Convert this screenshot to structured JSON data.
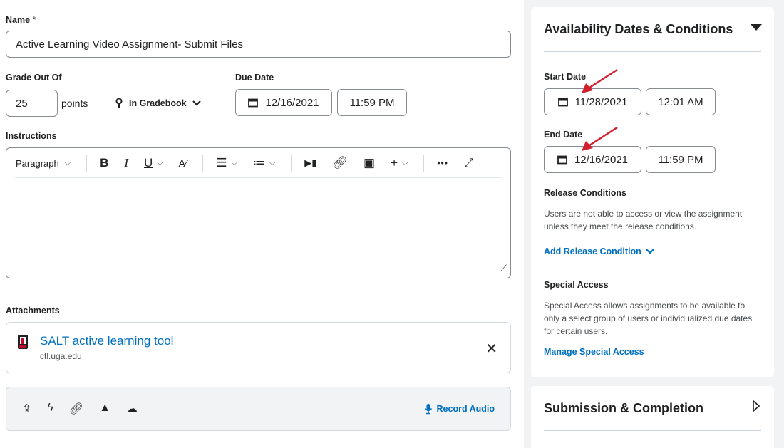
{
  "form": {
    "name_label": "Name",
    "name_required": "*",
    "name_value": "Active Learning Video Assignment- Submit Files",
    "grade_label": "Grade Out Of",
    "grade_value": "25",
    "grade_unit": "points",
    "gradebook_label": "In Gradebook",
    "due_label": "Due Date",
    "due_date": "12/16/2021",
    "due_time": "11:59 PM",
    "instructions_label": "Instructions",
    "toolbar": {
      "paragraph": "Paragraph",
      "bold": "B",
      "italic": "I",
      "underline": "U",
      "more": "•••"
    },
    "attachments_label": "Attachments",
    "attachment": {
      "title": "SALT active learning tool",
      "subtitle": "ctl.uga.edu"
    },
    "record_audio": "Record Audio"
  },
  "availability": {
    "title": "Availability Dates & Conditions",
    "start_label": "Start Date",
    "start_date": "11/28/2021",
    "start_time": "12:01 AM",
    "end_label": "End Date",
    "end_date": "12/16/2021",
    "end_time": "11:59 PM",
    "release_label": "Release Conditions",
    "release_text": "Users are not able to access or view the assignment unless they meet the release conditions.",
    "add_release": "Add Release Condition",
    "special_label": "Special Access",
    "special_text": "Special Access allows assignments to be available to only a select group of users or individualized due dates for certain users.",
    "manage_special": "Manage Special Access"
  },
  "submission": {
    "title": "Submission & Completion"
  },
  "colors": {
    "link": "#006fbf",
    "arrow": "#d0202e"
  }
}
